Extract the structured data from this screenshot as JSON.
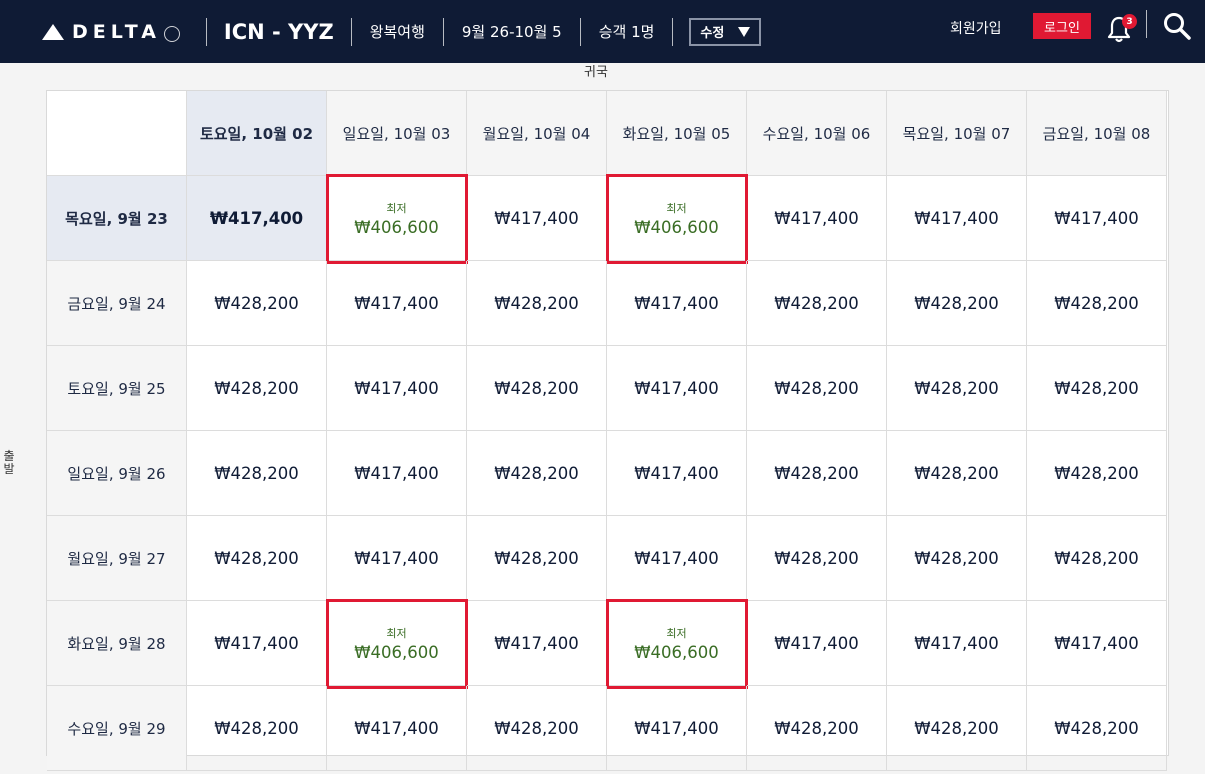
{
  "header": {
    "logo_text": "DELTA",
    "route": "ICN - YYZ",
    "trip_type": "왕복여행",
    "dates": "9월 26-10월 5",
    "passengers": "승객 1명",
    "edit_label": "수정",
    "signup": "회원가입",
    "login": "로그인",
    "notification_count": "3"
  },
  "axis": {
    "return_label": "귀국",
    "depart_label": "출발"
  },
  "colors": {
    "header_bg": "#0f1b35",
    "accent_red": "#e01933",
    "lowest_green": "#3a6d25",
    "selected_bg": "#e6eaf2"
  },
  "grid": {
    "return_dates": [
      {
        "label": "토요일, 10월 02",
        "selected": true
      },
      {
        "label": "일요일, 10월 03",
        "selected": false
      },
      {
        "label": "월요일, 10월 04",
        "selected": false
      },
      {
        "label": "화요일, 10월 05",
        "selected": false
      },
      {
        "label": "수요일, 10월 06",
        "selected": false
      },
      {
        "label": "목요일, 10월 07",
        "selected": false
      },
      {
        "label": "금요일, 10월 08",
        "selected": false
      }
    ],
    "rows": [
      {
        "label": "목요일, 9월 23",
        "selected": true,
        "prices": [
          {
            "value": "₩417,400",
            "lowest": false
          },
          {
            "value": "₩406,600",
            "lowest": true
          },
          {
            "value": "₩417,400",
            "lowest": false
          },
          {
            "value": "₩406,600",
            "lowest": true
          },
          {
            "value": "₩417,400",
            "lowest": false
          },
          {
            "value": "₩417,400",
            "lowest": false
          },
          {
            "value": "₩417,400",
            "lowest": false
          }
        ]
      },
      {
        "label": "금요일, 9월 24",
        "selected": false,
        "prices": [
          {
            "value": "₩428,200",
            "lowest": false
          },
          {
            "value": "₩417,400",
            "lowest": false
          },
          {
            "value": "₩428,200",
            "lowest": false
          },
          {
            "value": "₩417,400",
            "lowest": false
          },
          {
            "value": "₩428,200",
            "lowest": false
          },
          {
            "value": "₩428,200",
            "lowest": false
          },
          {
            "value": "₩428,200",
            "lowest": false
          }
        ]
      },
      {
        "label": "토요일, 9월 25",
        "selected": false,
        "prices": [
          {
            "value": "₩428,200",
            "lowest": false
          },
          {
            "value": "₩417,400",
            "lowest": false
          },
          {
            "value": "₩428,200",
            "lowest": false
          },
          {
            "value": "₩417,400",
            "lowest": false
          },
          {
            "value": "₩428,200",
            "lowest": false
          },
          {
            "value": "₩428,200",
            "lowest": false
          },
          {
            "value": "₩428,200",
            "lowest": false
          }
        ]
      },
      {
        "label": "일요일, 9월 26",
        "selected": false,
        "prices": [
          {
            "value": "₩428,200",
            "lowest": false
          },
          {
            "value": "₩417,400",
            "lowest": false
          },
          {
            "value": "₩428,200",
            "lowest": false
          },
          {
            "value": "₩417,400",
            "lowest": false
          },
          {
            "value": "₩428,200",
            "lowest": false
          },
          {
            "value": "₩428,200",
            "lowest": false
          },
          {
            "value": "₩428,200",
            "lowest": false
          }
        ]
      },
      {
        "label": "월요일, 9월 27",
        "selected": false,
        "prices": [
          {
            "value": "₩428,200",
            "lowest": false
          },
          {
            "value": "₩417,400",
            "lowest": false
          },
          {
            "value": "₩428,200",
            "lowest": false
          },
          {
            "value": "₩417,400",
            "lowest": false
          },
          {
            "value": "₩428,200",
            "lowest": false
          },
          {
            "value": "₩428,200",
            "lowest": false
          },
          {
            "value": "₩428,200",
            "lowest": false
          }
        ]
      },
      {
        "label": "화요일, 9월 28",
        "selected": false,
        "prices": [
          {
            "value": "₩417,400",
            "lowest": false
          },
          {
            "value": "₩406,600",
            "lowest": true
          },
          {
            "value": "₩417,400",
            "lowest": false
          },
          {
            "value": "₩406,600",
            "lowest": true
          },
          {
            "value": "₩417,400",
            "lowest": false
          },
          {
            "value": "₩417,400",
            "lowest": false
          },
          {
            "value": "₩417,400",
            "lowest": false
          }
        ]
      },
      {
        "label": "수요일, 9월 29",
        "selected": false,
        "prices": [
          {
            "value": "₩428,200",
            "lowest": false
          },
          {
            "value": "₩417,400",
            "lowest": false
          },
          {
            "value": "₩428,200",
            "lowest": false
          },
          {
            "value": "₩417,400",
            "lowest": false
          },
          {
            "value": "₩428,200",
            "lowest": false
          },
          {
            "value": "₩428,200",
            "lowest": false
          },
          {
            "value": "₩428,200",
            "lowest": false
          }
        ]
      }
    ],
    "lowest_tag": "최저"
  }
}
